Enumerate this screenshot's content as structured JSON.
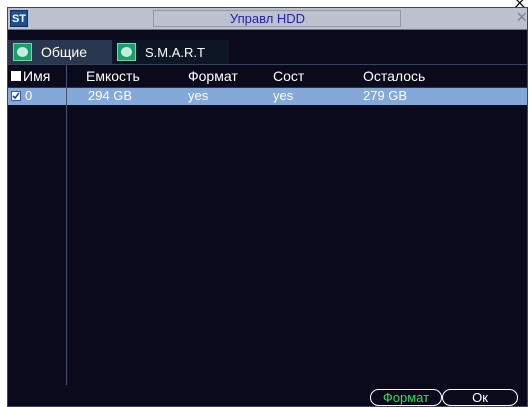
{
  "window": {
    "logo": "ST",
    "title": "Управл HDD",
    "close": "×"
  },
  "tabs": [
    {
      "label": "Общие",
      "active": true
    },
    {
      "label": "S.M.A.R.T",
      "active": false
    }
  ],
  "table": {
    "headers": [
      "Имя",
      "Емкость",
      "Формат",
      "Сост",
      "Осталось"
    ],
    "header_checkbox": false,
    "rows": [
      {
        "checked": true,
        "name": "0",
        "capacity": "294 GB",
        "format": "yes",
        "state": "yes",
        "remaining": "279 GB"
      }
    ]
  },
  "buttons": {
    "format": "Формат",
    "ok": "Ок"
  },
  "colors": {
    "background": "#0a0a1c",
    "selected_row": "#84a8d8",
    "format_button_text": "#33dd55"
  }
}
